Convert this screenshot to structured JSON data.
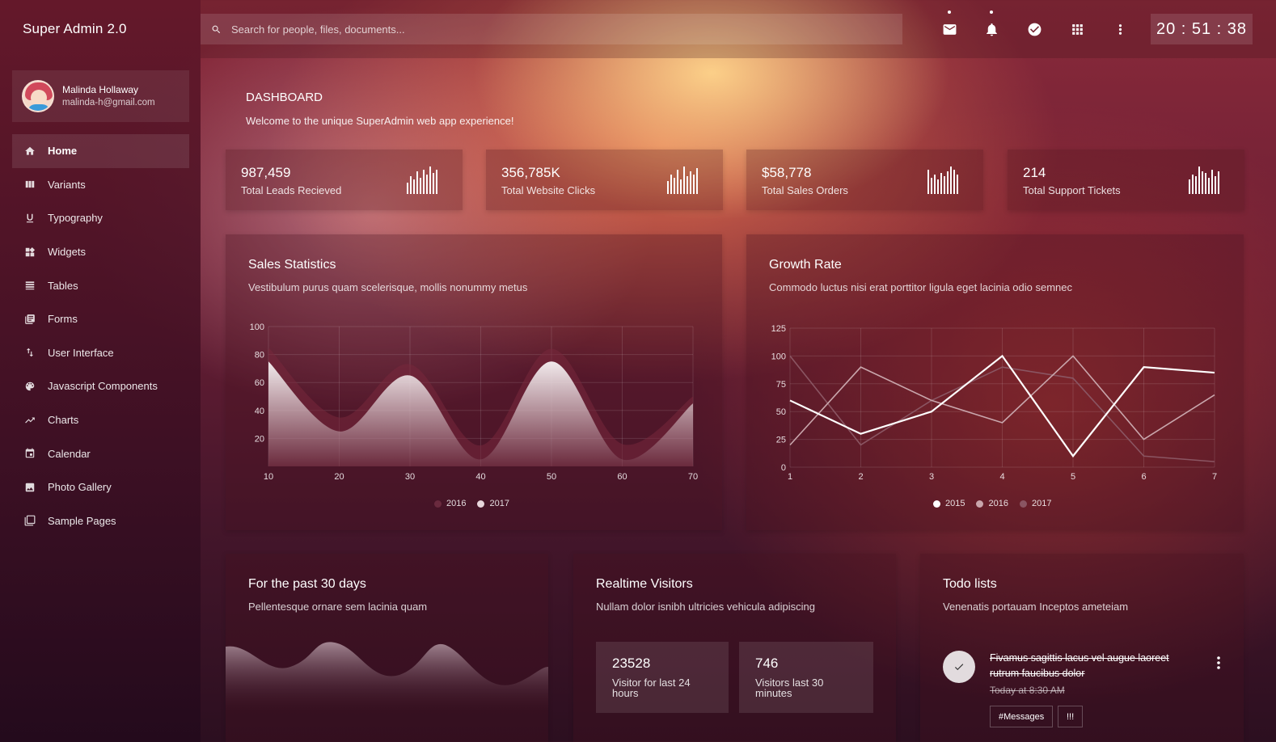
{
  "app": {
    "title": "Super Admin 2.0"
  },
  "user": {
    "name": "Malinda Hollaway",
    "email": "malinda-h@gmail.com"
  },
  "sidebar": {
    "items": [
      {
        "label": "Home",
        "icon": "home-icon",
        "active": true
      },
      {
        "label": "Variants",
        "icon": "columns-icon"
      },
      {
        "label": "Typography",
        "icon": "underline-icon"
      },
      {
        "label": "Widgets",
        "icon": "widgets-icon"
      },
      {
        "label": "Tables",
        "icon": "table-icon"
      },
      {
        "label": "Forms",
        "icon": "forms-icon"
      },
      {
        "label": "User Interface",
        "icon": "swap-icon"
      },
      {
        "label": "Javascript Components",
        "icon": "palette-icon"
      },
      {
        "label": "Charts",
        "icon": "trending-up-icon"
      },
      {
        "label": "Calendar",
        "icon": "calendar-icon"
      },
      {
        "label": "Photo Gallery",
        "icon": "image-icon"
      },
      {
        "label": "Sample Pages",
        "icon": "pages-icon"
      }
    ]
  },
  "topbar": {
    "search_placeholder": "Search for people, files, documents...",
    "clock": "20 : 51 : 38"
  },
  "page": {
    "title": "DASHBOARD",
    "subtitle": "Welcome to the unique SuperAdmin web app experience!"
  },
  "stats": [
    {
      "value": "987,459",
      "label": "Total Leads Recieved"
    },
    {
      "value": "356,785K",
      "label": "Total Website Clicks"
    },
    {
      "value": "$58,778",
      "label": "Total Sales Orders"
    },
    {
      "value": "214",
      "label": "Total Support Tickets"
    }
  ],
  "sales_card": {
    "title": "Sales Statistics",
    "subtitle": "Vestibulum purus quam scelerisque, mollis nonummy metus",
    "legend": [
      "2016",
      "2017"
    ]
  },
  "growth_card": {
    "title": "Growth Rate",
    "subtitle": "Commodo luctus nisi erat porttitor ligula eget lacinia odio semnec",
    "legend": [
      "2015",
      "2016",
      "2017"
    ]
  },
  "past_card": {
    "title": "For the past 30 days",
    "subtitle": "Pellentesque ornare sem lacinia quam"
  },
  "realtime_card": {
    "title": "Realtime Visitors",
    "subtitle": "Nullam dolor isnibh ultricies vehicula adipiscing",
    "boxes": [
      {
        "value": "23528",
        "label": "Visitor for last 24 hours"
      },
      {
        "value": "746",
        "label": "Visitors last 30 minutes"
      }
    ]
  },
  "todo_card": {
    "title": "Todo lists",
    "subtitle": "Venenatis portauam Inceptos ameteiam",
    "item": {
      "text": "Fivamus sagittis lacus vel augue laoreet rutrum faucibus dolor",
      "time": "Today at 8:30 AM",
      "tags": [
        "#Messages",
        "!!!"
      ]
    }
  },
  "chart_data": [
    {
      "type": "area",
      "xlim": [
        10,
        70
      ],
      "ylim": [
        0,
        100
      ],
      "x_ticks": [
        10,
        20,
        30,
        40,
        50,
        60,
        70
      ],
      "y_ticks": [
        20,
        40,
        60,
        80,
        100
      ],
      "series": [
        {
          "name": "2016",
          "x": [
            10,
            20,
            30,
            40,
            50,
            60,
            70
          ],
          "values": [
            85,
            35,
            73,
            15,
            84,
            16,
            50
          ],
          "color": "#6a2a3e"
        },
        {
          "name": "2017",
          "x": [
            10,
            20,
            30,
            40,
            50,
            60,
            70
          ],
          "values": [
            75,
            25,
            65,
            5,
            75,
            5,
            45
          ],
          "color": "#ffffff"
        }
      ]
    },
    {
      "type": "line",
      "xlim": [
        1,
        7
      ],
      "ylim": [
        0,
        125
      ],
      "x_ticks": [
        1,
        2,
        3,
        4,
        5,
        6,
        7
      ],
      "y_ticks": [
        0,
        25,
        50,
        75,
        100,
        125
      ],
      "series": [
        {
          "name": "2015",
          "x": [
            1,
            2,
            3,
            4,
            5,
            6,
            7
          ],
          "values": [
            60,
            30,
            50,
            100,
            10,
            90,
            85
          ],
          "color": "#ffffff"
        },
        {
          "name": "2016",
          "x": [
            1,
            2,
            3,
            4,
            5,
            6,
            7
          ],
          "values": [
            20,
            90,
            60,
            40,
            100,
            25,
            65
          ],
          "color": "#c9a6ac"
        },
        {
          "name": "2017",
          "x": [
            1,
            2,
            3,
            4,
            5,
            6,
            7
          ],
          "values": [
            100,
            20,
            60,
            90,
            80,
            10,
            5
          ],
          "color": "#8a5562"
        }
      ]
    }
  ]
}
